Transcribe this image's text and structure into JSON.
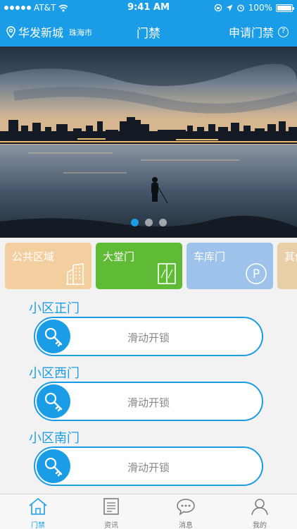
{
  "status_bar": {
    "carrier": "AT&T",
    "time": "9:41 AM",
    "battery": "100%",
    "battery_level": 1.0
  },
  "header": {
    "community": "华发新城",
    "city": "珠海市",
    "title": "门禁",
    "apply_label": "申请门禁",
    "help_glyph": "?"
  },
  "banner": {
    "page_count": 3,
    "active_page": 1
  },
  "categories": [
    {
      "label": "公共区域",
      "icon": "building-icon",
      "color": "#f3cfa0"
    },
    {
      "label": "大堂门",
      "icon": "door-icon",
      "color": "#5fbb35"
    },
    {
      "label": "车库门",
      "icon": "parking-icon",
      "color": "#9dc3ea"
    },
    {
      "label": "其他",
      "icon": "",
      "color": "#e8cfa8"
    }
  ],
  "parking_glyph": "P",
  "gates": [
    {
      "name": "小区正门",
      "slide_label": "滑动开锁"
    },
    {
      "name": "小区西门",
      "slide_label": "滑动开锁"
    },
    {
      "name": "小区南门",
      "slide_label": "滑动开锁"
    }
  ],
  "tabbar": [
    {
      "label": "门禁",
      "icon": "home-icon",
      "active": true
    },
    {
      "label": "资讯",
      "icon": "news-icon",
      "active": false
    },
    {
      "label": "消息",
      "icon": "message-icon",
      "active": false
    },
    {
      "label": "我的",
      "icon": "profile-icon",
      "active": false
    }
  ],
  "colors": {
    "brand_blue": "#1a9de6",
    "background": "#f2f2f2"
  }
}
